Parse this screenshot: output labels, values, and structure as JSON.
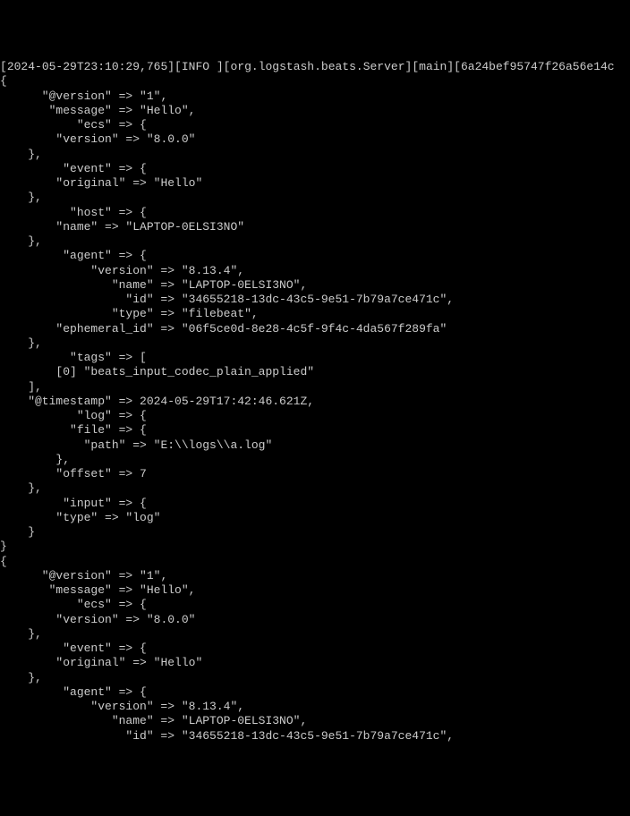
{
  "header": {
    "timestamp": "2024-05-29T23:10:29,765",
    "level": "INFO ",
    "logger": "org.logstash.beats.Server",
    "thread": "main",
    "hash": "6a24bef95747f26a56e14c"
  },
  "event1": {
    "version": "1",
    "message": "Hello",
    "ecs_version": "8.0.0",
    "event_original": "Hello",
    "host_name": "LAPTOP-0ELSI3NO",
    "agent": {
      "version": "8.13.4",
      "name": "LAPTOP-0ELSI3NO",
      "id": "34655218-13dc-43c5-9e51-7b79a7ce471c",
      "type": "filebeat",
      "ephemeral_id": "06f5ce0d-8e28-4c5f-9f4c-4da567f289fa"
    },
    "tag0": "beats_input_codec_plain_applied",
    "timestamp": "2024-05-29T17:42:46.621Z",
    "log_file_path": "E:\\\\logs\\\\a.log",
    "log_offset": "7",
    "input_type": "log"
  },
  "event2": {
    "version": "1",
    "message": "Hello",
    "ecs_version": "8.0.0",
    "event_original": "Hello",
    "agent": {
      "version": "8.13.4",
      "name": "LAPTOP-0ELSI3NO",
      "id": "34655218-13dc-43c5-9e51-7b79a7ce471c"
    }
  }
}
